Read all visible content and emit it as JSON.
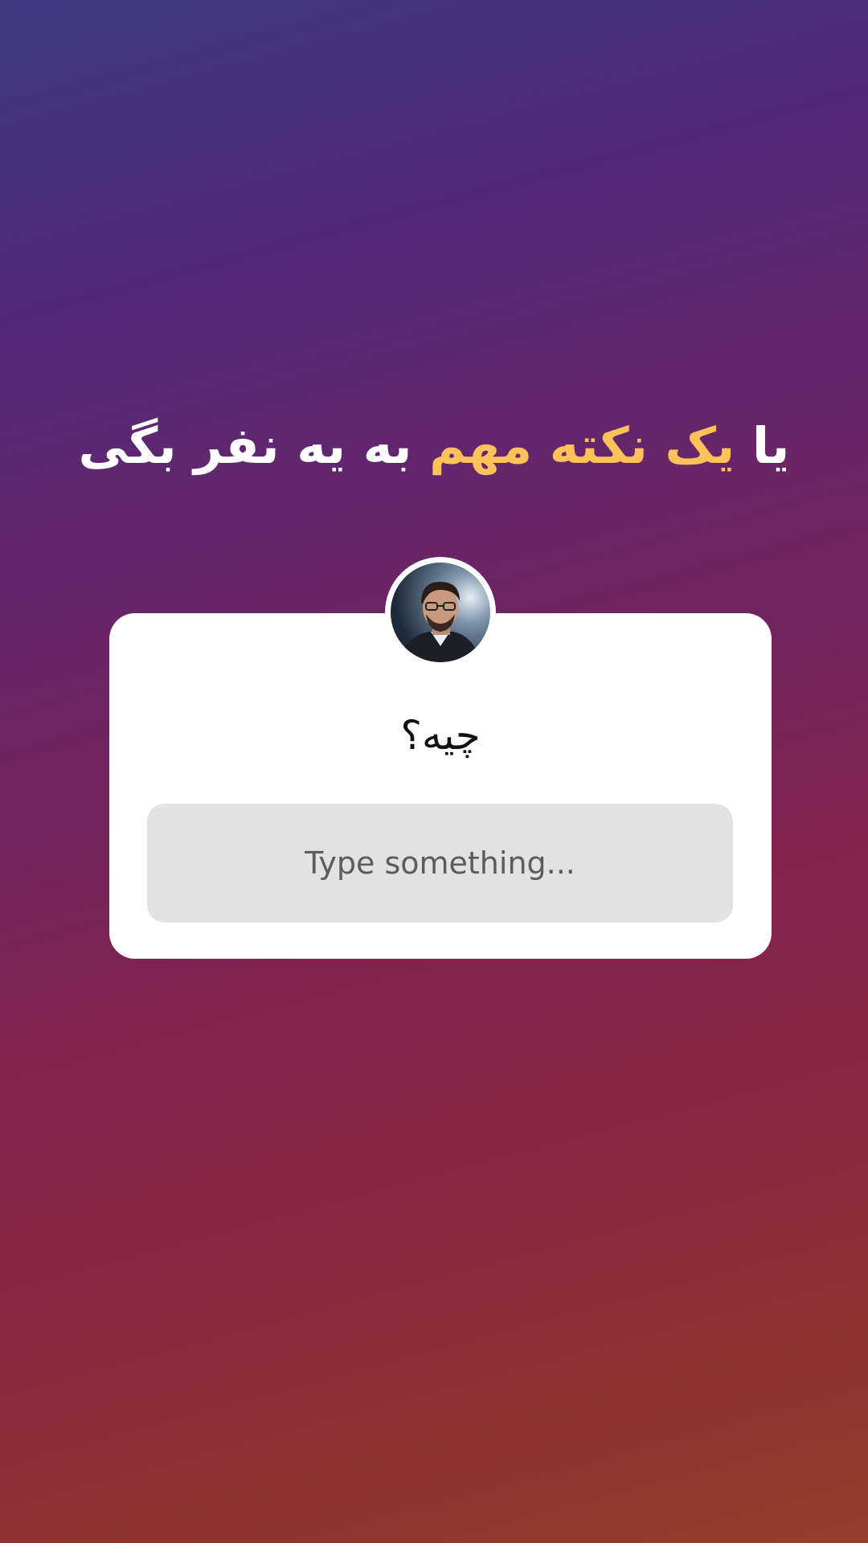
{
  "headline": {
    "part1": "یا ",
    "highlight": "یک نکته مهم",
    "part2": " به یه نفر بگی",
    "accent_color": "#ffc15a"
  },
  "question_sticker": {
    "avatar_icon": "profile-photo",
    "question": "چیه؟",
    "placeholder": "Type something..."
  }
}
